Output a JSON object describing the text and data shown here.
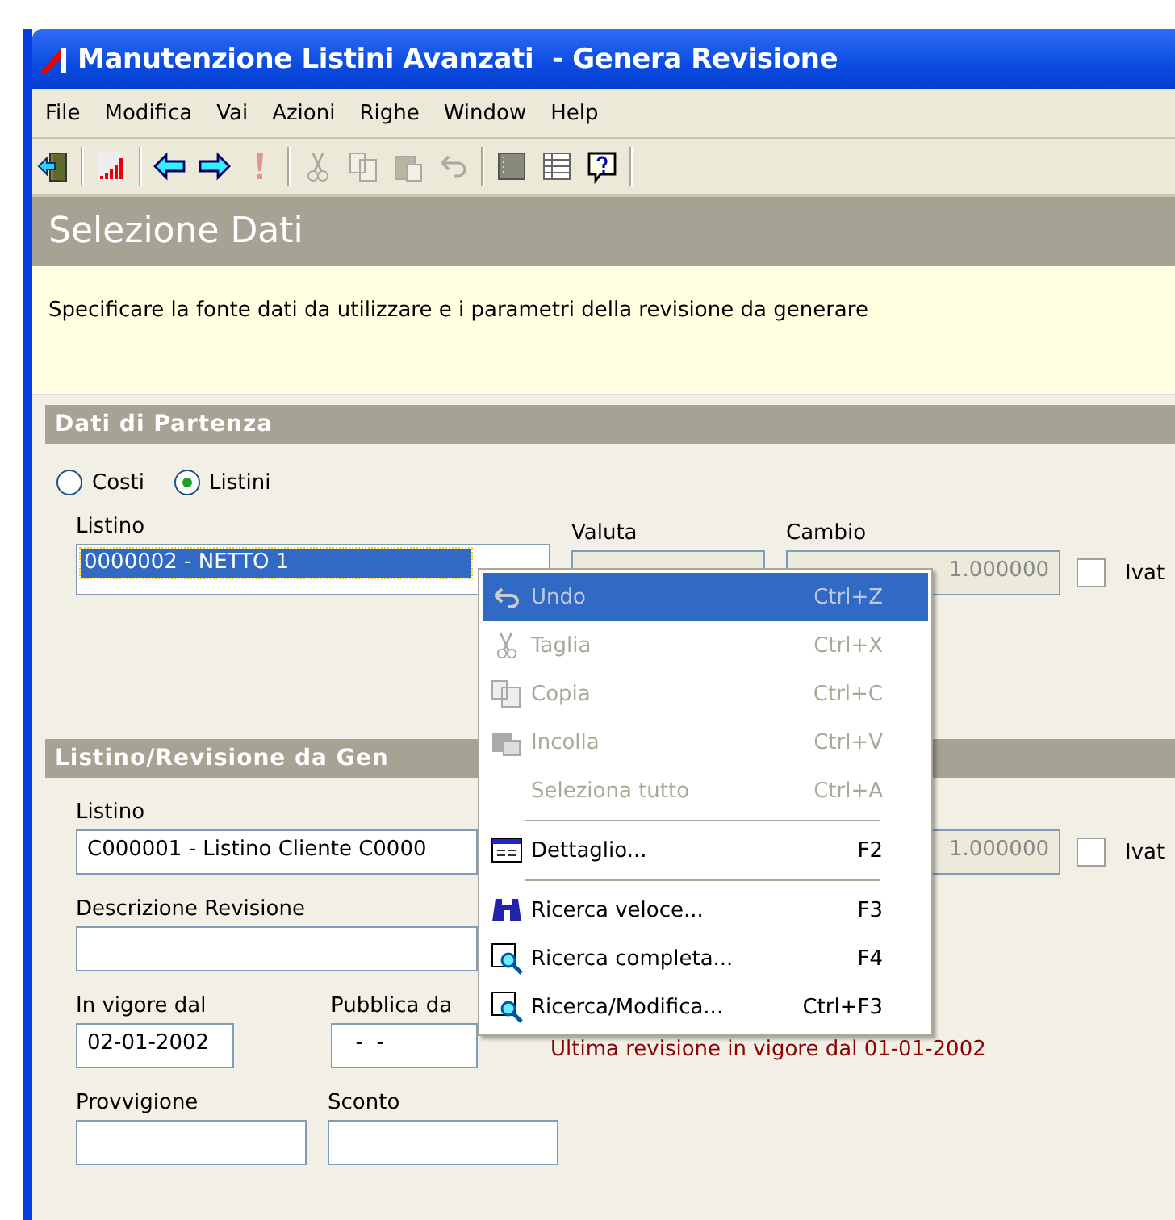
{
  "window": {
    "title": "Manutenzione Listini Avanzati  - Genera Revisione"
  },
  "menubar": [
    "File",
    "Modifica",
    "Vai",
    "Azioni",
    "Righe",
    "Window",
    "Help"
  ],
  "toolbar": [
    {
      "kind": "exit",
      "disabled": false
    },
    {
      "kind": "sep"
    },
    {
      "kind": "signal",
      "disabled": false
    },
    {
      "kind": "sep"
    },
    {
      "kind": "back",
      "disabled": false
    },
    {
      "kind": "forward",
      "disabled": false
    },
    {
      "kind": "alert",
      "disabled": true
    },
    {
      "kind": "sep"
    },
    {
      "kind": "cut",
      "disabled": true
    },
    {
      "kind": "copy",
      "disabled": true
    },
    {
      "kind": "paste",
      "disabled": true
    },
    {
      "kind": "undo",
      "disabled": true
    },
    {
      "kind": "sep"
    },
    {
      "kind": "block",
      "disabled": false
    },
    {
      "kind": "table",
      "disabled": false
    },
    {
      "kind": "help",
      "disabled": false
    },
    {
      "kind": "sep"
    }
  ],
  "page_title": "Selezione Dati",
  "info": "Specificare la fonte dati da utilizzare e i parametri della revisione da generare",
  "section1": {
    "title": "Dati di Partenza",
    "radios": [
      {
        "label": "Costi",
        "selected": false
      },
      {
        "label": "Listini",
        "selected": true
      }
    ],
    "listino": {
      "label": "Listino",
      "value": "0000002 - NETTO 1"
    },
    "valuta": {
      "label": "Valuta"
    },
    "cambio": {
      "label": "Cambio",
      "value": "1.000000"
    },
    "ivato": {
      "label": "Ivat",
      "checked": false
    }
  },
  "section2": {
    "title": "Listino/Revisione da Gen",
    "listino": {
      "label": "Listino",
      "value": "C000001 - Listino Cliente C0000"
    },
    "cambio": {
      "value": "1.000000"
    },
    "ivato": {
      "label": "Ivat",
      "checked": false
    },
    "descrizione": {
      "label": "Descrizione Revisione"
    },
    "in_vigore": {
      "label": "In vigore dal",
      "value": "02-01-2002"
    },
    "pubblica": {
      "label": "Pubblica da",
      "value": "  -  -"
    },
    "note": "Ultima revisione in vigore dal 01-01-2002",
    "provvigione": {
      "label": "Provvigione"
    },
    "sconto": {
      "label": "Sconto"
    }
  },
  "context_menu": [
    {
      "kind": "item",
      "label": "Undo",
      "shortcut": "Ctrl+Z",
      "disabled": true,
      "selected": true
    },
    {
      "kind": "item",
      "label": "Taglia",
      "shortcut": "Ctrl+X",
      "disabled": true,
      "selected": false
    },
    {
      "kind": "item",
      "label": "Copia",
      "shortcut": "Ctrl+C",
      "disabled": true,
      "selected": false
    },
    {
      "kind": "item",
      "label": "Incolla",
      "shortcut": "Ctrl+V",
      "disabled": true,
      "selected": false
    },
    {
      "kind": "item",
      "label": "Seleziona tutto",
      "shortcut": "Ctrl+A",
      "disabled": true,
      "selected": false
    },
    {
      "kind": "separator"
    },
    {
      "kind": "item",
      "label": "Dettaglio...",
      "shortcut": "F2",
      "disabled": false,
      "selected": false
    },
    {
      "kind": "separator"
    },
    {
      "kind": "item",
      "label": "Ricerca veloce...",
      "shortcut": "F3",
      "disabled": false,
      "selected": false
    },
    {
      "kind": "item",
      "label": "Ricerca completa...",
      "shortcut": "F4",
      "disabled": false,
      "selected": false
    },
    {
      "kind": "item",
      "label": "Ricerca/Modifica...",
      "shortcut": "Ctrl+F3",
      "disabled": false,
      "selected": false
    }
  ]
}
